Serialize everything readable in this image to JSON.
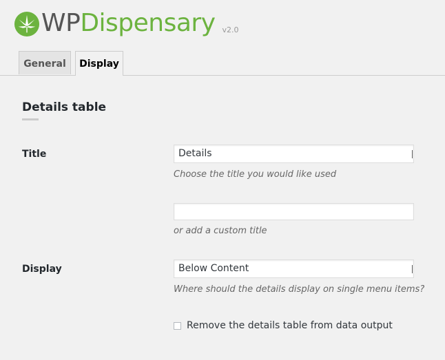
{
  "header": {
    "logo_text_wp": "WP",
    "logo_text_dispensary": "Dispensary",
    "version": "v2.0",
    "brand_color": "#6cb33f"
  },
  "tabs": [
    {
      "label": "General",
      "active": false
    },
    {
      "label": "Display",
      "active": true
    }
  ],
  "section": {
    "title": "Details table"
  },
  "fields": {
    "title": {
      "label": "Title",
      "select_value": "Details",
      "select_description": "Choose the title you would like used",
      "custom_value": "",
      "custom_description": "or add a custom title"
    },
    "display": {
      "label": "Display",
      "select_value": "Below Content",
      "description": "Where should the details display on single menu items?"
    },
    "remove_table": {
      "label": "Remove the details table from data output",
      "checked": false
    }
  }
}
